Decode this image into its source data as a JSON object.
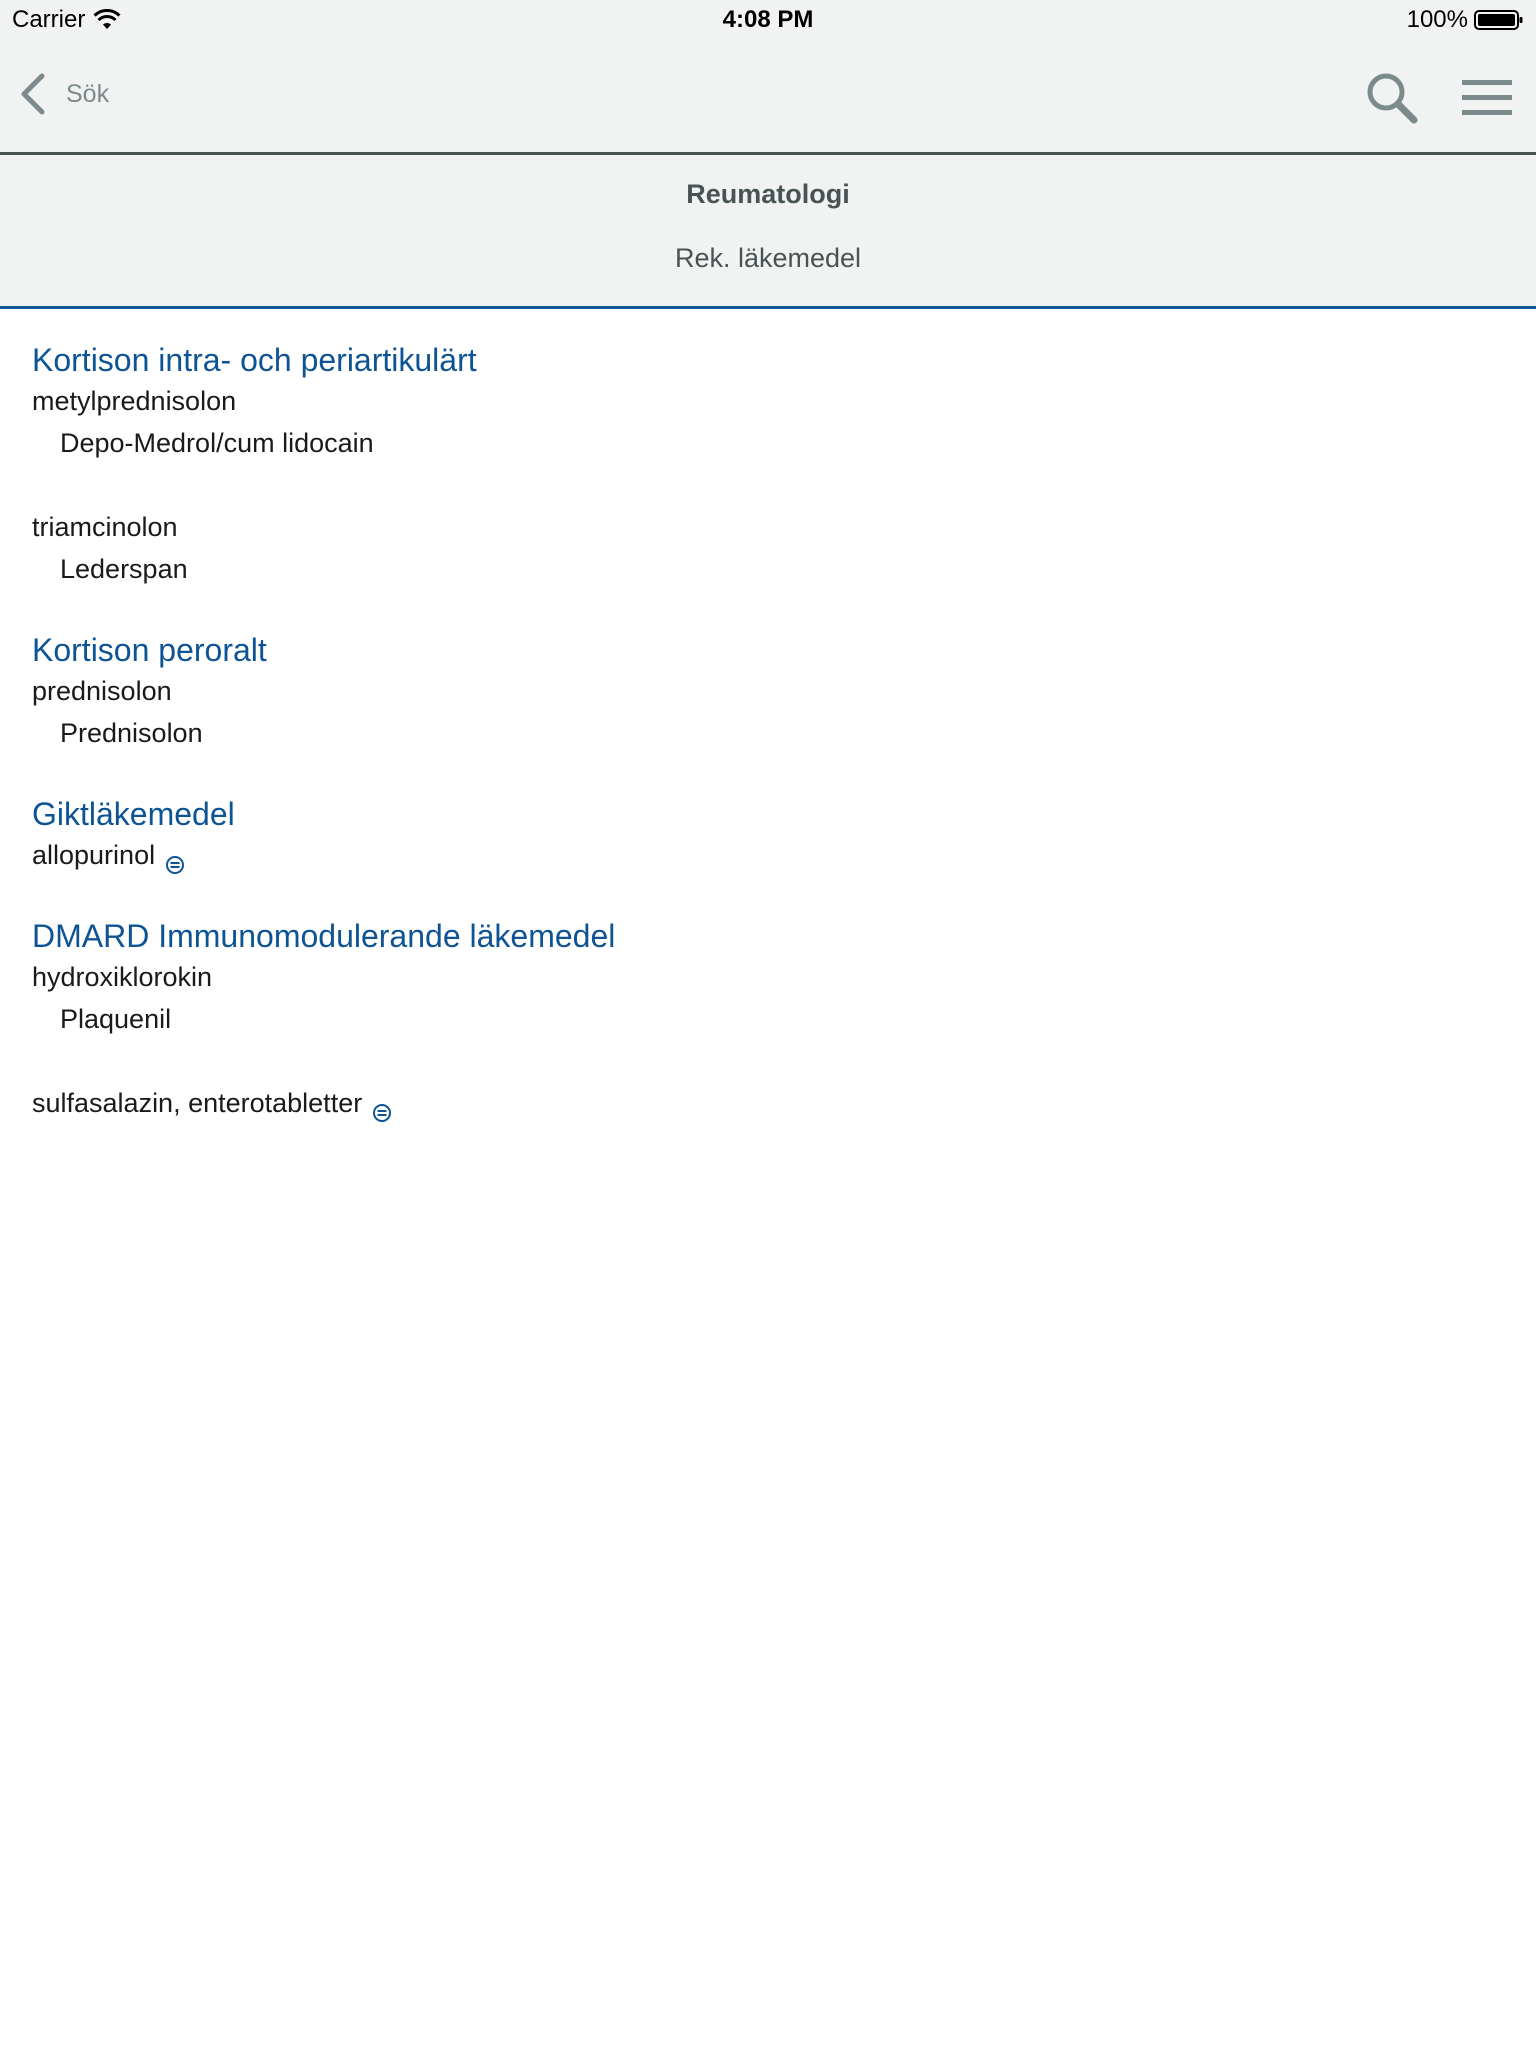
{
  "status_bar": {
    "carrier": "Carrier",
    "time": "4:08 PM",
    "battery": "100%"
  },
  "nav": {
    "back_label": "Sök"
  },
  "header": {
    "title": "Reumatologi",
    "subtitle": "Rek. läkemedel"
  },
  "colors": {
    "accent_blue": "#0e5495",
    "nav_gray": "#7d8a8b",
    "header_bg": "#f1f2f2"
  },
  "sections": [
    {
      "title": "Kortison intra- och periartikulärt",
      "drugs": [
        {
          "name": "metylprednisolon",
          "brand": "Depo-Medrol/cum lidocain"
        },
        {
          "name": "triamcinolon",
          "brand": "Lederspan"
        }
      ]
    },
    {
      "title": "Kortison peroralt",
      "drugs": [
        {
          "name": "prednisolon",
          "brand": "Prednisolon"
        }
      ]
    },
    {
      "title": "Giktläkemedel",
      "drugs": [
        {
          "name": "allopurinol",
          "icon": "equivalent-icon"
        }
      ]
    },
    {
      "title": "DMARD Immunomodulerande läkemedel",
      "drugs": [
        {
          "name": "hydroxiklorokin",
          "brand": "Plaquenil"
        },
        {
          "name": "sulfasalazin, enterotabletter",
          "icon": "equivalent-icon"
        }
      ]
    }
  ]
}
